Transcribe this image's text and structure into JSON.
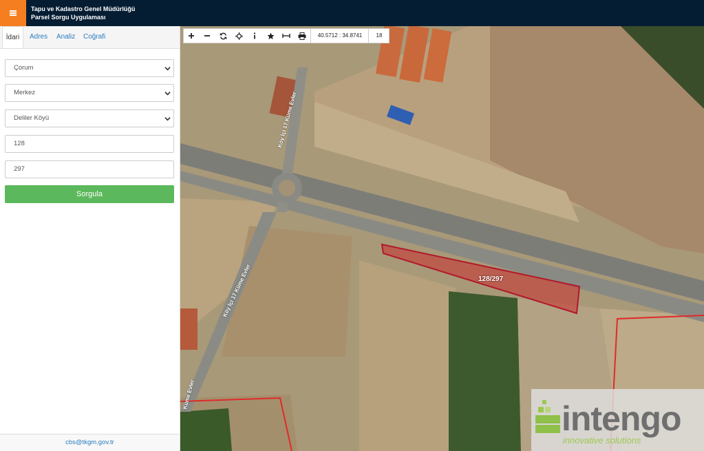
{
  "header": {
    "title_line1": "Tapu ve Kadastro Genel Müdürlüğü",
    "title_line2": "Parsel Sorgu Uygulaması"
  },
  "sidebar": {
    "tabs": [
      {
        "label": "İdari"
      },
      {
        "label": "Adres"
      },
      {
        "label": "Analiz"
      },
      {
        "label": "Coğrafi"
      }
    ],
    "province": "Çorum",
    "district": "Merkez",
    "neighborhood": "Deliler Köyü",
    "block": "128",
    "parcel": "297",
    "query_button": "Sorgula",
    "footer_email": "cbs@tkgm.gov.tr"
  },
  "map": {
    "coordinates": "40.5712 : 34.8741",
    "zoom": "18",
    "parcel_label": "128/297",
    "road_label_1": "Köy İçi 17 Küme Evler",
    "road_label_2": "Köy İçi 17 Küme Evler",
    "road_label_3": "Küme Evler",
    "watermark_brand": "intengo",
    "watermark_tagline": "innovative solutions"
  },
  "colors": {
    "header_bg": "#041d33",
    "menu_accent": "#f57f20",
    "query_button": "#5cb85c",
    "parcel_outline": "#b0192a",
    "link": "#2a7bbd"
  }
}
